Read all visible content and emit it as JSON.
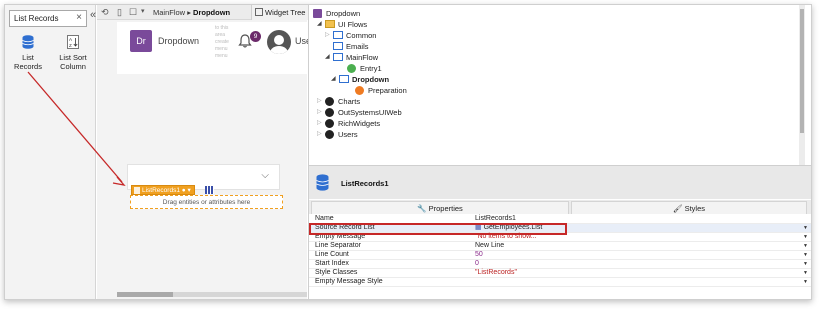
{
  "toolbox": {
    "search_value": "List Records",
    "tools": [
      {
        "label": "List Records"
      },
      {
        "label": "List Sort Column"
      }
    ]
  },
  "canvas": {
    "breadcrumb_parent": "MainFlow",
    "breadcrumb_current": "Dropdown",
    "logo_text": "Dr",
    "app_name": "Dropdown",
    "menu_hint": "to this area create menu menu",
    "notification_count": "9",
    "user_label": "User",
    "widget_tag_label": "ListRecords1",
    "drop_zone_text": "Drag entities or attributes here"
  },
  "widget_tree_tab": "Widget Tree",
  "tree": {
    "root": "Dropdown",
    "items": [
      {
        "label": "UI Flows"
      },
      {
        "label": "Common"
      },
      {
        "label": "Emails"
      },
      {
        "label": "MainFlow"
      },
      {
        "label": "Entry1"
      },
      {
        "label": "Dropdown"
      },
      {
        "label": "Preparation"
      },
      {
        "label": "Charts"
      },
      {
        "label": "OutSystemsUIWeb"
      },
      {
        "label": "RichWidgets"
      },
      {
        "label": "Users"
      }
    ]
  },
  "properties": {
    "title": "ListRecords1",
    "tab_properties": "Properties",
    "tab_styles": "Styles",
    "rows": [
      {
        "name": "Name",
        "value": "ListRecords1"
      },
      {
        "name": "Source Record List",
        "value": "GetEmployees.List"
      },
      {
        "name": "Empty Message",
        "value": "\"No items to show...\""
      },
      {
        "name": "Line Separator",
        "value": "New Line"
      },
      {
        "name": "Line Count",
        "value": "50"
      },
      {
        "name": "Start Index",
        "value": "0"
      },
      {
        "name": "Style Classes",
        "value": "\"ListRecords\""
      },
      {
        "name": "Empty Message Style",
        "value": ""
      }
    ]
  },
  "colors": {
    "annotation_red": "#c62828",
    "widget_orange": "#f0a020",
    "logo_purple": "#7a4a9a"
  }
}
